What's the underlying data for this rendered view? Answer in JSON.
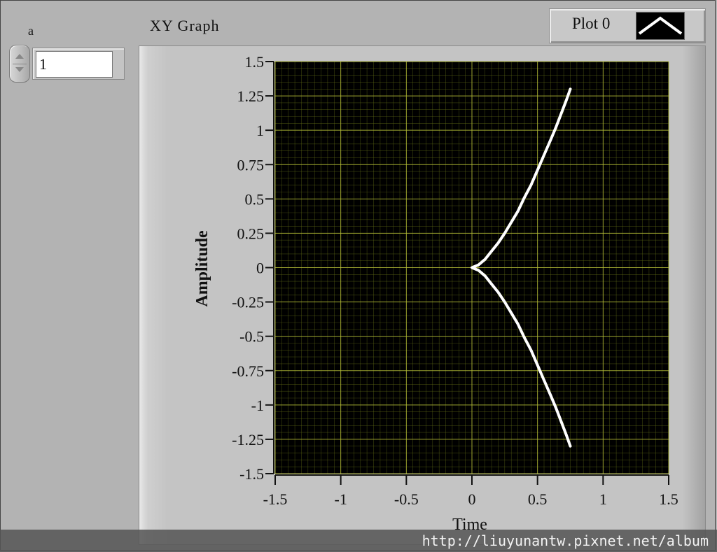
{
  "control": {
    "label": "a",
    "value": "1"
  },
  "graph": {
    "label": "XY Graph",
    "legend": {
      "plot_name": "Plot 0"
    }
  },
  "colors": {
    "plot_background": "#000000",
    "grid": "#6e7a1a",
    "curve": "#ffffff"
  },
  "footer": {
    "watermark": "http://liuyunantw.pixnet.net/album"
  },
  "chart_data": {
    "type": "line",
    "title": "XY Graph",
    "xlabel": "Time",
    "ylabel": "Amplitude",
    "xlim": [
      -1.5,
      1.5
    ],
    "ylim": [
      -1.5,
      1.5
    ],
    "x_ticks": [
      -1.5,
      -1,
      -0.5,
      0,
      0.5,
      1,
      1.5
    ],
    "x_tick_labels": [
      "-1.5",
      "-1",
      "-0.5",
      "0",
      "0.5",
      "1",
      "1.5"
    ],
    "y_ticks": [
      1.5,
      1.25,
      1,
      0.75,
      0.5,
      0.25,
      0,
      -0.25,
      -0.5,
      -0.75,
      -1,
      -1.25,
      -1.5
    ],
    "y_tick_labels": [
      "1.5",
      "1.25",
      "1",
      "0.75",
      "0.5",
      "0.25",
      "0",
      "-0.25",
      "-0.5",
      "-0.75",
      "-1",
      "-1.25",
      "-1.5"
    ],
    "grid": true,
    "series": [
      {
        "name": "Plot 0",
        "x": [
          0.75,
          0.72,
          0.68,
          0.64,
          0.6,
          0.55,
          0.5,
          0.45,
          0.4,
          0.35,
          0.3,
          0.25,
          0.2,
          0.15,
          0.1,
          0.05,
          0.0,
          0.05,
          0.1,
          0.15,
          0.2,
          0.25,
          0.3,
          0.35,
          0.4,
          0.45,
          0.5,
          0.55,
          0.6,
          0.64,
          0.68,
          0.72,
          0.75
        ],
        "y": [
          1.3,
          1.22,
          1.12,
          1.02,
          0.93,
          0.82,
          0.71,
          0.6,
          0.51,
          0.41,
          0.33,
          0.25,
          0.18,
          0.12,
          0.06,
          0.02,
          0.0,
          -0.02,
          -0.06,
          -0.12,
          -0.18,
          -0.25,
          -0.33,
          -0.41,
          -0.51,
          -0.6,
          -0.71,
          -0.82,
          -0.93,
          -1.02,
          -1.12,
          -1.22,
          -1.3
        ]
      }
    ]
  }
}
